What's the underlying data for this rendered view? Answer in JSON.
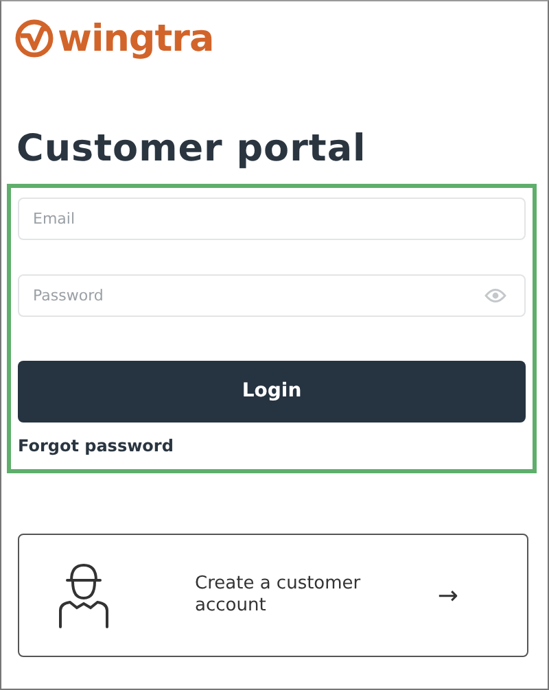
{
  "logo": {
    "text": "wingtra"
  },
  "title": "Customer portal",
  "login_form": {
    "email": {
      "placeholder": "Email"
    },
    "password": {
      "placeholder": "Password"
    },
    "login_button": "Login",
    "forgot_link": "Forgot password"
  },
  "create_account": {
    "text": "Create a customer account",
    "arrow": "→"
  }
}
